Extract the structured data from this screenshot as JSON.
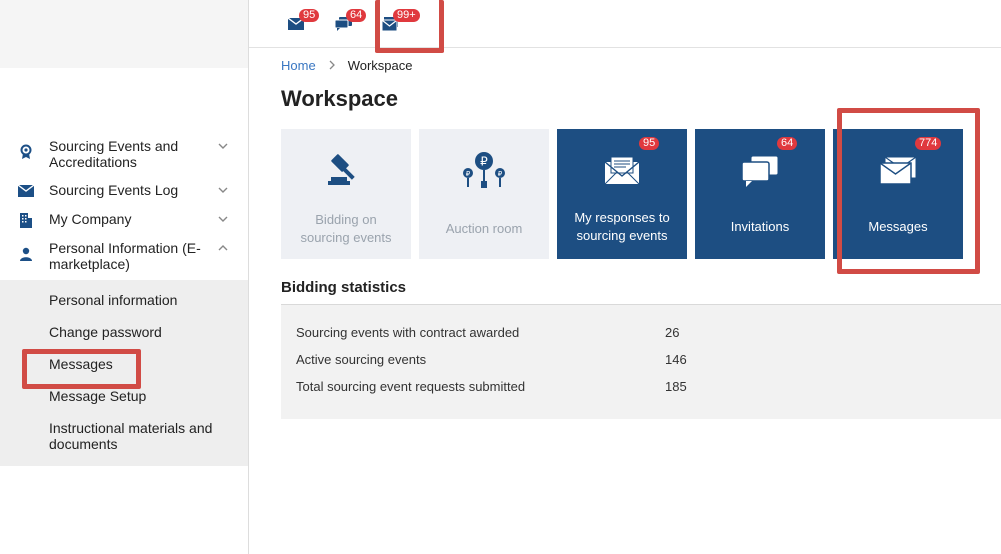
{
  "topbar": {
    "badges": [
      "95",
      "64",
      "99+"
    ]
  },
  "sidebar": {
    "items": [
      {
        "label": "Sourcing Events and Accreditations",
        "icon": "award-icon"
      },
      {
        "label": "Sourcing Events Log",
        "icon": "envelope-icon"
      },
      {
        "label": "My Company",
        "icon": "building-icon"
      },
      {
        "label": "Personal Information (E-marketplace)",
        "icon": "person-icon"
      }
    ],
    "submenu": [
      "Personal information",
      "Change password",
      "Messages",
      "Message Setup",
      "Instructional materials and documents"
    ]
  },
  "breadcrumb": {
    "home": "Home",
    "current": "Workspace"
  },
  "page": {
    "title": "Workspace"
  },
  "tiles": [
    {
      "label": "Bidding on sourcing events",
      "icon": "gavel-icon",
      "badge": ""
    },
    {
      "label": "Auction room",
      "icon": "auction-icon",
      "badge": ""
    },
    {
      "label": "My responses to sourcing events",
      "icon": "document-envelope-icon",
      "badge": "95"
    },
    {
      "label": "Invitations",
      "icon": "chat-icon",
      "badge": "64"
    },
    {
      "label": "Messages",
      "icon": "envelopes-icon",
      "badge": "774"
    }
  ],
  "stats": {
    "title": "Bidding statistics",
    "rows": [
      {
        "label": "Sourcing events with contract awarded",
        "value": "26"
      },
      {
        "label": "Active sourcing events",
        "value": "146"
      },
      {
        "label": "Total sourcing event requests submitted",
        "value": "185"
      }
    ]
  },
  "colors": {
    "primary": "#1d4e82",
    "badge": "#e0393e",
    "highlight": "#d14b45",
    "link": "#3a77c2"
  }
}
